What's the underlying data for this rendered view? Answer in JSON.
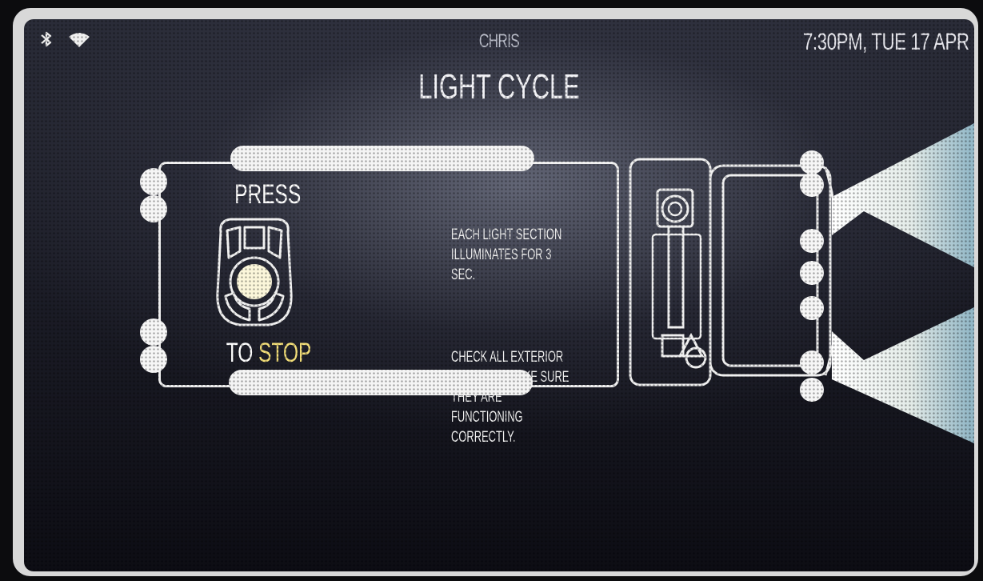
{
  "status_bar": {
    "user": "CHRIS",
    "datetime": "7:30PM, TUE 17 APR",
    "icons": [
      "bluetooth-icon",
      "wifi-icon"
    ]
  },
  "page": {
    "title": "LIGHT CYCLE"
  },
  "instruction": {
    "press": "PRESS",
    "to": "TO",
    "stop": "STOP",
    "paragraph1": "EACH LIGHT SECTION\nILLUMINATES FOR 3 SEC.",
    "paragraph2": "CHECK ALL EXTERIOR\nLIGHTS TO MAKE SURE\nTHEY ARE FUNCTIONING\nCORRECTLY."
  },
  "colors": {
    "accent": "#f4e07a",
    "text": "#f0f0f0",
    "background": "#1b1c26"
  }
}
